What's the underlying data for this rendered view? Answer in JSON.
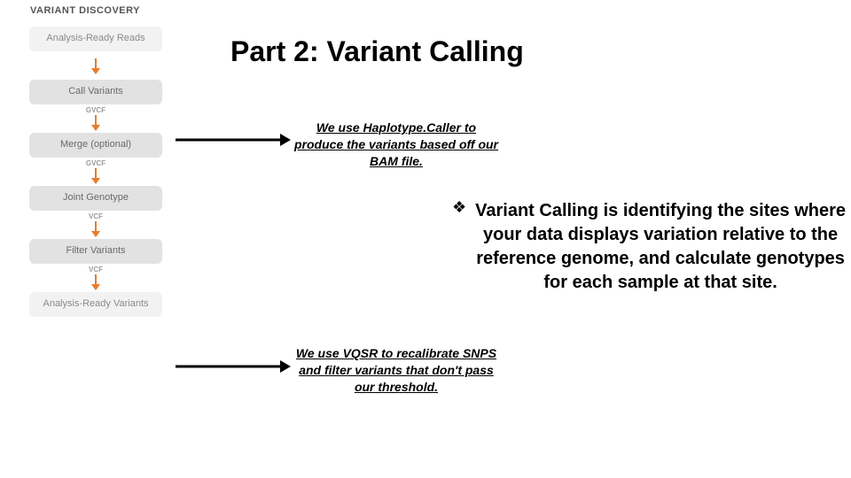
{
  "title": "Part 2:  Variant Calling",
  "workflow": {
    "header": "VARIANT DISCOVERY",
    "steps": [
      {
        "label": "Analysis-Ready Reads",
        "tone": "light"
      },
      {
        "label": "Call Variants",
        "tone": "mid"
      },
      {
        "label": "Merge (optional)",
        "tone": "mid"
      },
      {
        "label": "Joint Genotype",
        "tone": "mid"
      },
      {
        "label": "Filter Variants",
        "tone": "mid"
      },
      {
        "label": "Analysis-Ready Variants",
        "tone": "light"
      }
    ],
    "connectors": [
      "",
      "GVCF",
      "GVCF",
      "VCF",
      "VCF"
    ]
  },
  "annotations": {
    "call_variants_note": "We use Haplotype.Caller to produce the variants based off our BAM file.",
    "filter_variants_note": "We use VQSR to recalibrate SNPS and filter variants that don't pass our threshold."
  },
  "description": {
    "bullet_glyph": "❖",
    "text": "Variant Calling is identifying the sites where your data displays variation relative to the reference genome, and calculate genotypes for each sample at that site."
  },
  "colors": {
    "arrow_orange": "#e87b2b"
  }
}
